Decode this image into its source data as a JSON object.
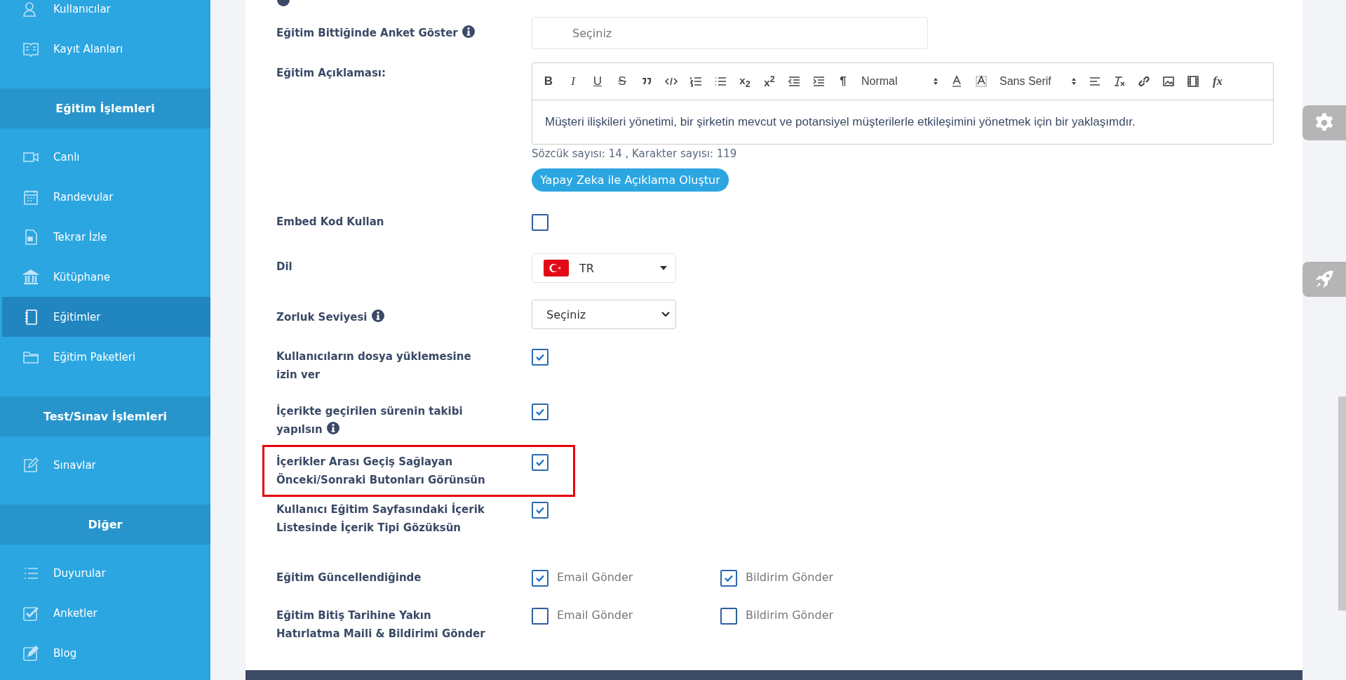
{
  "sidebar": {
    "groups": [
      {
        "items": [
          {
            "label": "Kullanıcılar",
            "active": false
          },
          {
            "label": "Kayıt Alanları",
            "active": false
          }
        ]
      },
      {
        "title": "Eğitim İşlemleri",
        "items": [
          {
            "label": "Canlı",
            "active": false
          },
          {
            "label": "Randevular",
            "active": false
          },
          {
            "label": "Tekrar İzle",
            "active": false
          },
          {
            "label": "Kütüphane",
            "active": false
          },
          {
            "label": "Eğitimler",
            "active": true
          },
          {
            "label": "Eğitim Paketleri",
            "active": false
          }
        ]
      },
      {
        "title": "Test/Sınav İşlemleri",
        "items": [
          {
            "label": "Sınavlar",
            "active": false
          }
        ]
      },
      {
        "title": "Diğer",
        "items": [
          {
            "label": "Duyurular",
            "active": false
          },
          {
            "label": "Anketler",
            "active": false
          },
          {
            "label": "Blog",
            "active": false
          }
        ]
      }
    ]
  },
  "form": [
    {
      "kind": "select",
      "label": "Eğitim Bittiğinde Anket Göster",
      "info": true,
      "placeholder": "Seçiniz"
    },
    {
      "kind": "editor",
      "label": "Eğitim Açıklaması:",
      "toolbar": [
        {
          "kind": "bold",
          "label": "B"
        },
        {
          "kind": "italic",
          "label": "I"
        },
        {
          "kind": "underline",
          "label": "U"
        },
        {
          "kind": "strike",
          "label": "S"
        },
        {
          "kind": "quote"
        },
        {
          "kind": "code"
        },
        {
          "kind": "ordered"
        },
        {
          "kind": "bullet"
        },
        {
          "kind": "script",
          "label": "x$_{2}$"
        },
        {
          "kind": "script",
          "label": "x$^{2}$"
        },
        {
          "kind": "outdent"
        },
        {
          "kind": "indent"
        },
        {
          "kind": "direction",
          "label": "¶"
        },
        {
          "kind": "picker",
          "label": "Normal"
        },
        {
          "kind": "color"
        },
        {
          "kind": "background"
        },
        {
          "kind": "picker",
          "label": "Sans Serif"
        },
        {
          "kind": "align"
        },
        {
          "kind": "clean"
        },
        {
          "kind": "link"
        },
        {
          "kind": "image"
        },
        {
          "kind": "video"
        },
        {
          "kind": "formula",
          "label": "fx"
        }
      ],
      "value": "Müşteri ilişkileri yönetimi, bir şirketin mevcut ve potansiyel müşterilerle etkileşimini yönetmek için bir yaklaşımdır.",
      "counter": "Sözcük sayısı: 14 , Karakter sayısı: 119",
      "button": "Yapay Zeka ile Açıklama Oluştur"
    },
    {
      "kind": "checkbox",
      "label": "Embed Kod Kullan",
      "checked": false,
      "highlighted": false
    },
    {
      "kind": "language",
      "label": "Dil",
      "value": "TR"
    },
    {
      "kind": "dropdown",
      "label": "Zorluk Seviyesi",
      "info": true,
      "value": "Seçiniz"
    },
    {
      "kind": "checkbox",
      "label": "Kullanıcıların dosya yüklemesine izin ver",
      "checked": true,
      "highlighted": false
    },
    {
      "kind": "checkbox",
      "label": "İçerikte geçirilen sürenin takibi yapılsın",
      "info": true,
      "checked": true,
      "highlighted": false
    },
    {
      "kind": "checkbox",
      "label": "İçerikler Arası Geçiş Sağlayan Önceki/Sonraki Butonları Görünsün",
      "checked": true,
      "highlighted": true
    },
    {
      "kind": "checkbox",
      "label": "Kullanıcı Eğitim Sayfasındaki İçerik Listesinde İçerik Tipi Gözüksün",
      "checked": true,
      "highlighted": false
    },
    {
      "kind": "pair",
      "label": "Eğitim Güncellendiğinde",
      "options": [
        {
          "label": "Email Gönder",
          "checked": true
        },
        {
          "label": "Bildirim Gönder",
          "checked": true
        }
      ]
    },
    {
      "kind": "pair",
      "label": "Eğitim Bitiş Tarihine Yakın Hatırlatma Maili & Bildirimi Gönder",
      "options": [
        {
          "label": "Email Gönder",
          "checked": false
        },
        {
          "label": "Bildirim Gönder",
          "checked": false
        }
      ]
    }
  ]
}
